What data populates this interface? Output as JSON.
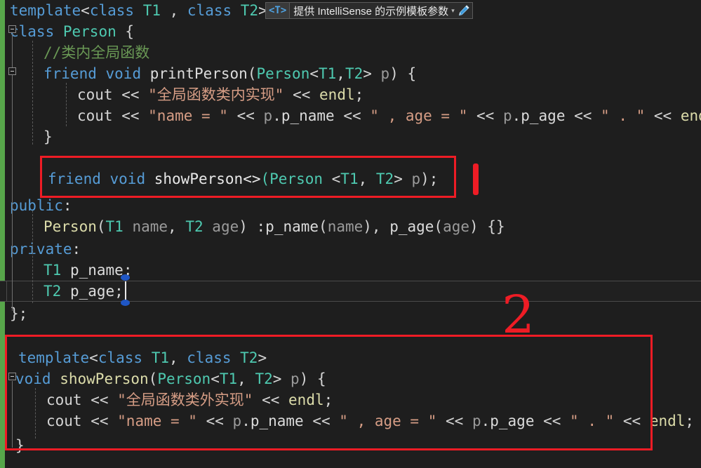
{
  "editor": {
    "background": "#1e1e1e",
    "current_line_background": "#202020",
    "change_bar_color": "#57a64a",
    "annotation_color": "#ee1c25"
  },
  "hint": {
    "tag": "<T>",
    "text": "提供 IntelliSense 的示例模板参数",
    "caret": "▾",
    "pencil_icon": "pencil-icon"
  },
  "annotations": {
    "mark_one": "1",
    "mark_two": "2"
  },
  "code": {
    "line1": {
      "t1": "template",
      "t2": "<",
      "t3": "class",
      "t4": " ",
      "t5": "T1",
      "t6": " , ",
      "t7": "class",
      "t8": " ",
      "t9": "T2",
      "t10": ">"
    },
    "line2": {
      "t1": "class",
      "t2": " ",
      "t3": "Person",
      "t4": " {"
    },
    "line3": {
      "t1": "//类内全局函数"
    },
    "line4": {
      "t1": "friend",
      "t2": " ",
      "t3": "void",
      "t4": " ",
      "t5": "printPerson",
      "t6": "(",
      "t7": "Person",
      "t8": "<",
      "t9": "T1",
      "t10": ",",
      "t11": "T2",
      "t12": "> ",
      "t13": "p",
      "t14": ") {"
    },
    "line5": {
      "t1": "cout",
      "t2": " << ",
      "t3": "\"全局函数类内实现\"",
      "t4": " << ",
      "t5": "endl",
      "t6": ";"
    },
    "line6": {
      "t1": "cout",
      "t2": " << ",
      "t3": "\"name = \"",
      "t4": " << ",
      "t5": "p",
      "t6": ".",
      "t7": "p_name",
      "t8": " << ",
      "t9": "\" , age = \"",
      "t10": " << ",
      "t11": "p",
      "t12": ".",
      "t13": "p_age",
      "t14": " << ",
      "t15": "\" . \"",
      "t16": " << ",
      "t17": "endl",
      "t18": ";"
    },
    "line7": {
      "t1": "}"
    },
    "line8": {
      "t1": ""
    },
    "line9": {
      "t1": "friend",
      "t2": " ",
      "t3": "void",
      "t4": " ",
      "t5": "showPerson",
      "t6": "<>",
      "t7": "(",
      "t8": "Person",
      "t9": " <",
      "t10": "T1",
      "t11": ", ",
      "t12": "T2",
      "t13": "> ",
      "t14": "p",
      "t15": ");"
    },
    "line10": {
      "t1": "public",
      "t2": ":"
    },
    "line11": {
      "t1": "Person",
      "t2": "(",
      "t3": "T1",
      "t4": " ",
      "t5": "name",
      "t6": ", ",
      "t7": "T2",
      "t8": " ",
      "t9": "age",
      "t10": ") :",
      "t11": "p_name",
      "t12": "(",
      "t13": "name",
      "t14": "), ",
      "t15": "p_age",
      "t16": "(",
      "t17": "age",
      "t18": ") {}"
    },
    "line12": {
      "t1": "private",
      "t2": ":"
    },
    "line13": {
      "t1": "T1",
      "t2": " ",
      "t3": "p_name",
      "t4": ";"
    },
    "line14": {
      "t1": "T2",
      "t2": " ",
      "t3": "p_age",
      "t4": ";"
    },
    "line15": {
      "t1": "};"
    },
    "line16": {
      "t1": ""
    },
    "line17": {
      "t1": ""
    },
    "line18": {
      "t1": "template",
      "t2": "<",
      "t3": "class",
      "t4": " ",
      "t5": "T1",
      "t6": ", ",
      "t7": "class",
      "t8": " ",
      "t9": "T2",
      "t10": ">"
    },
    "line19": {
      "t1": "void",
      "t2": " ",
      "t3": "showPerson",
      "t4": "(",
      "t5": "Person",
      "t6": "<",
      "t7": "T1",
      "t8": ", ",
      "t9": "T2",
      "t10": "> ",
      "t11": "p",
      "t12": ") {"
    },
    "line20": {
      "t1": "cout",
      "t2": " << ",
      "t3": "\"全局函数类外实现\"",
      "t4": " << ",
      "t5": "endl",
      "t6": ";"
    },
    "line21": {
      "t1": "cout",
      "t2": " << ",
      "t3": "\"name = \"",
      "t4": " << ",
      "t5": "p",
      "t6": ".",
      "t7": "p_name",
      "t8": " << ",
      "t9": "\" , age = \"",
      "t10": " << ",
      "t11": "p",
      "t12": ".",
      "t13": "p_age",
      "t14": " << ",
      "t15": "\" . \"",
      "t16": " << ",
      "t17": "endl",
      "t18": ";"
    },
    "line22": {
      "t1": "}"
    }
  }
}
